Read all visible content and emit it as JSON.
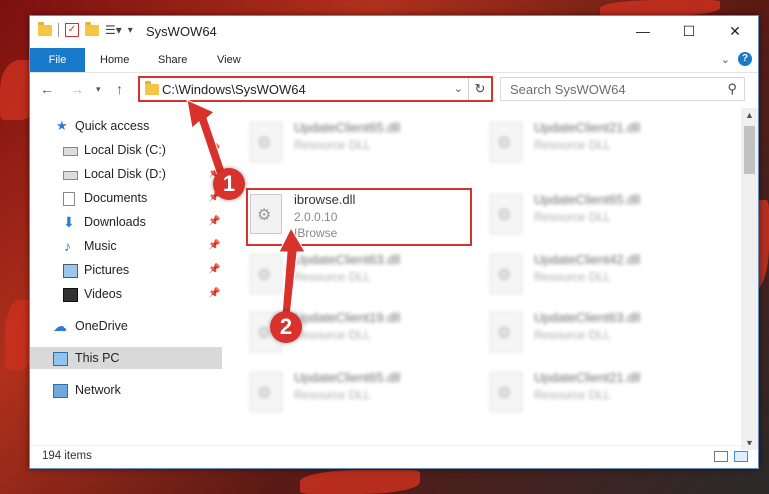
{
  "window": {
    "title": "SysWOW64",
    "controls": {
      "minimize": "—",
      "maximize": "☐",
      "close": "✕"
    }
  },
  "ribbon": {
    "tabs": [
      {
        "label": "File"
      },
      {
        "label": "Home"
      },
      {
        "label": "Share"
      },
      {
        "label": "View"
      }
    ],
    "help": "?"
  },
  "address": {
    "path": "C:\\Windows\\SysWOW64",
    "search_placeholder": "Search SysWOW64"
  },
  "nav": {
    "items": [
      {
        "label": "Quick access",
        "icon": "star-icon"
      },
      {
        "label": "Local Disk (C:)",
        "icon": "drive-icon"
      },
      {
        "label": "Local Disk (D:)",
        "icon": "drive-icon"
      },
      {
        "label": "Documents",
        "icon": "documents-icon"
      },
      {
        "label": "Downloads",
        "icon": "download-icon"
      },
      {
        "label": "Music",
        "icon": "music-icon"
      },
      {
        "label": "Pictures",
        "icon": "pictures-icon"
      },
      {
        "label": "Videos",
        "icon": "videos-icon"
      },
      {
        "label": "OneDrive",
        "icon": "cloud-icon"
      },
      {
        "label": "This PC",
        "icon": "computer-icon"
      },
      {
        "label": "Network",
        "icon": "network-icon"
      }
    ]
  },
  "files": {
    "highlighted": {
      "name": "ibrowse.dll",
      "version": "2.0.0.10",
      "desc": "IBrowse"
    },
    "blurred": [
      {
        "name": "UpdateClient65.dll",
        "desc": "Resource DLL"
      },
      {
        "name": "UpdateClient21.dll",
        "desc": "Resource DLL"
      },
      {
        "name": "UpdateClient65.dll",
        "desc": "Resource DLL"
      },
      {
        "name": "UpdateClient63.dll",
        "desc": "Resource DLL"
      },
      {
        "name": "UpdateClient42.dll",
        "desc": "Resource DLL"
      },
      {
        "name": "UpdateClient19.dll",
        "desc": "Resource DLL"
      },
      {
        "name": "UpdateClient63.dll",
        "desc": "Resource DLL"
      },
      {
        "name": "UpdateClient65.dll",
        "desc": "Resource DLL"
      },
      {
        "name": "UpdateClient21.dll",
        "desc": "Resource DLL"
      }
    ]
  },
  "status": {
    "item_count": "194 items"
  },
  "callouts": {
    "one": "1",
    "two": "2"
  },
  "colors": {
    "accent": "#1979ca",
    "highlight": "#d8322c"
  }
}
